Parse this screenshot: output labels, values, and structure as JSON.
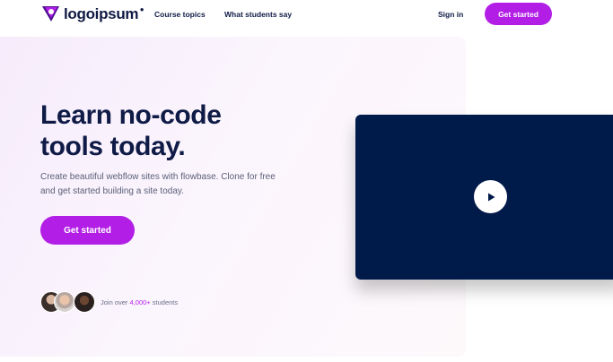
{
  "nav": {
    "logo_text": "logoipsum",
    "logo_mark_color": "#7a16c8",
    "links": [
      "Course topics",
      "What students say"
    ],
    "signin_label": "Sign in",
    "cta_label": "Get started"
  },
  "hero": {
    "title": "Learn no-code\ntools today.",
    "subtitle": "Create beautiful webflow sites with flowbase. Clone for free and get started building a site today.",
    "cta_label": "Get started",
    "social_proof": {
      "prefix": "Join over ",
      "count": "4,000+",
      "suffix": " students"
    }
  },
  "video": {
    "play_icon": "play-icon"
  },
  "colors": {
    "accent": "#b21ee6",
    "heading": "#0f1b46",
    "video_bg": "#001a4a"
  }
}
